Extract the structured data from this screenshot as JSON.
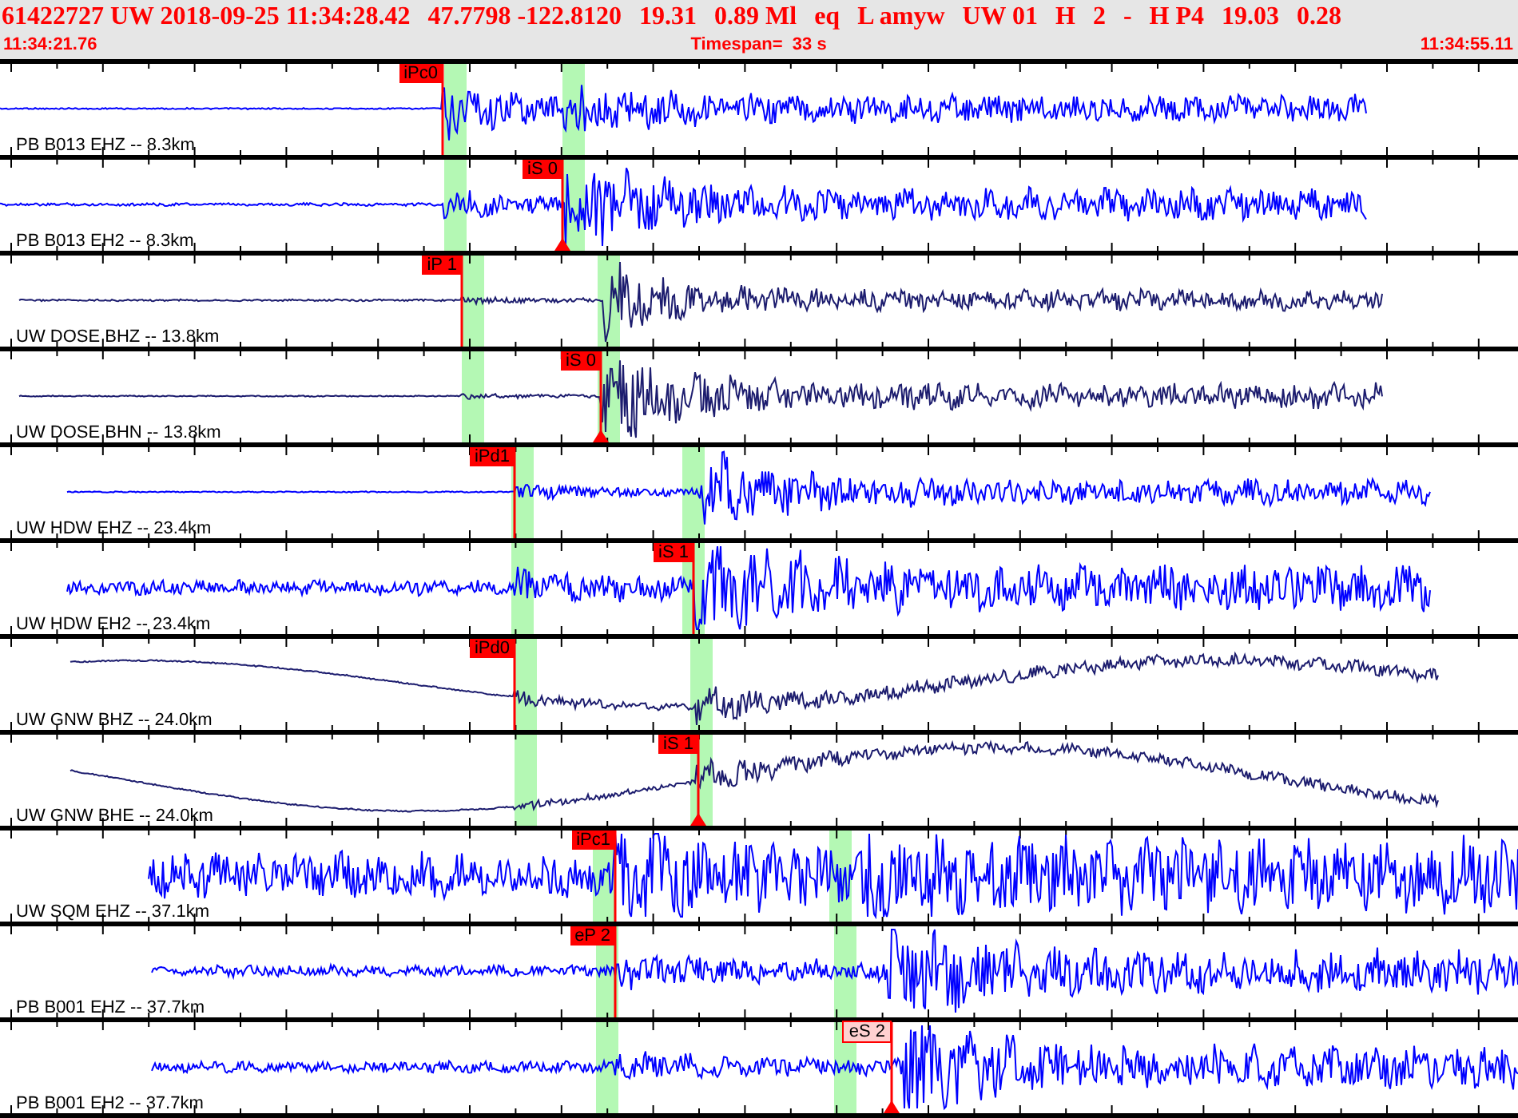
{
  "header": {
    "fields": [
      "61422727 UW 2018-09-25 11:34:28.42",
      "47.7798 -122.8120",
      "19.31",
      "0.89 Ml",
      "eq",
      "L amyw",
      "UW 01",
      "H",
      "2",
      "-",
      "H P4",
      "19.03",
      "0.28"
    ],
    "start_time": "11:34:21.76",
    "timespan": "Timespan=  33 s",
    "end_time": "11:34:55.11"
  },
  "traces": [
    {
      "label": "PB B013 EHZ -- 8.3km",
      "color": "#0000ff",
      "pick": {
        "label": "iPc0",
        "kind": "solid"
      }
    },
    {
      "label": "PB B013 EH2 -- 8.3km",
      "color": "#0000ff",
      "pick": {
        "label": "iS 0",
        "kind": "solid"
      }
    },
    {
      "label": "UW DOSE BHZ -- 13.8km",
      "color": "#1c1c6e",
      "pick": {
        "label": "iP 1",
        "kind": "solid"
      }
    },
    {
      "label": "UW DOSE BHN -- 13.8km",
      "color": "#1c1c6e",
      "pick": {
        "label": "iS 0",
        "kind": "solid"
      }
    },
    {
      "label": "UW HDW EHZ -- 23.4km",
      "color": "#0000ff",
      "pick": {
        "label": "iPd1",
        "kind": "solid"
      }
    },
    {
      "label": "UW HDW EH2 -- 23.4km",
      "color": "#0000ff",
      "pick": {
        "label": "iS 1",
        "kind": "solid"
      }
    },
    {
      "label": "UW GNW BHZ -- 24.0km",
      "color": "#1c1c6e",
      "pick": {
        "label": "iPd0",
        "kind": "solid"
      }
    },
    {
      "label": "UW GNW BHE -- 24.0km",
      "color": "#1c1c6e",
      "pick": {
        "label": "iS 1",
        "kind": "solid"
      }
    },
    {
      "label": "UW SQM EHZ -- 37.1km",
      "color": "#0000ff",
      "pick": {
        "label": "iPc1",
        "kind": "solid"
      }
    },
    {
      "label": "PB B001 EHZ -- 37.7km",
      "color": "#0000ff",
      "pick": {
        "label": "eP 2",
        "kind": "solid"
      }
    },
    {
      "label": "PB B001 EH2 -- 37.7km",
      "color": "#0000ff",
      "pick": {
        "label": "eS 2",
        "kind": "pale"
      }
    }
  ]
}
